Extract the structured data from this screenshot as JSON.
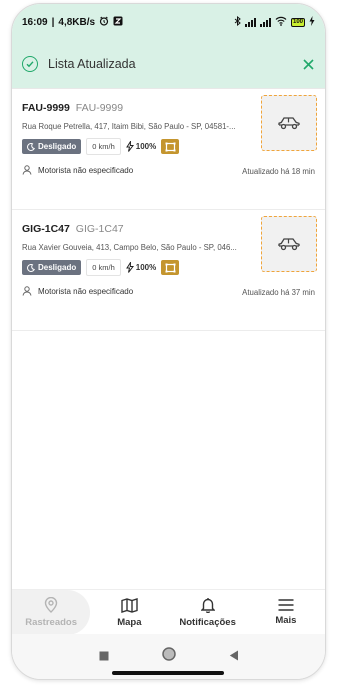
{
  "status_bar": {
    "time": "16:09",
    "network_speed": "4,8KB/s",
    "battery_level": "100"
  },
  "banner": {
    "title": "Lista Atualizada"
  },
  "vehicles": [
    {
      "plate": "FAU-9999",
      "plate_alt": "FAU-9999",
      "address": "Rua Roque Petrella, 417, Itaim Bibi, São Paulo - SP, 04581-...",
      "status": "Desligado",
      "speed": "0 km/h",
      "battery": "100%",
      "driver": "Motorista não especificado",
      "updated": "Atualizado há 18 min"
    },
    {
      "plate": "GIG-1C47",
      "plate_alt": "GIG-1C47",
      "address": "Rua Xavier Gouveia, 413, Campo Belo, São Paulo - SP, 046...",
      "status": "Desligado",
      "speed": "0 km/h",
      "battery": "100%",
      "driver": "Motorista não especificado",
      "updated": "Atualizado há 37 min"
    }
  ],
  "bottom_nav": [
    {
      "label": "Rastreados",
      "icon": "location-pin-icon",
      "active": true
    },
    {
      "label": "Mapa",
      "icon": "map-icon",
      "active": false
    },
    {
      "label": "Notificações",
      "icon": "bell-icon",
      "active": false
    },
    {
      "label": "Mais",
      "icon": "menu-icon",
      "active": false
    }
  ],
  "colors": {
    "accent": "#20a86a",
    "banner_bg": "#d9f1e6",
    "status_chip": "#6b7280",
    "car_border": "#f0a43a",
    "lock_box": "#c4952e"
  }
}
